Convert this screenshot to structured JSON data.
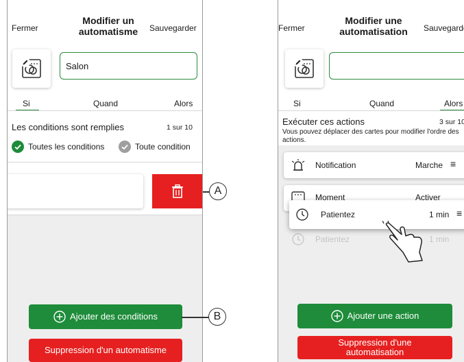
{
  "left": {
    "close_label": "Fermer",
    "title_line1": "Modifier un",
    "title_line2": "automatisme",
    "save_label": "Sauvegarder",
    "name_value": "Salon",
    "tabs": [
      "Si",
      "Quand",
      "Alors"
    ],
    "conditions_heading": "Les conditions sont remplies",
    "conditions_count": "1 sur 10",
    "option_all": "Toutes les conditions",
    "option_any": "Toute condition",
    "add_conditions_label": "Ajouter des conditions",
    "delete_automation_label": "Suppression d'un automatisme"
  },
  "right": {
    "close_label": "Fermer",
    "title_line1": "Modifier une",
    "title_line2": "automatisation",
    "save_label": "Sauvegarder",
    "tabs": [
      "Si",
      "Quand",
      "Alors"
    ],
    "actions_heading": "Exécuter ces actions",
    "actions_count": "3 sur 10",
    "actions_hint": "Vous pouvez déplacer des cartes pour modifier l'ordre des actions.",
    "actions": [
      {
        "label": "Notification",
        "value": "Marche"
      },
      {
        "label": "Moment",
        "value": "Activer"
      },
      {
        "label": "Patientez",
        "value": "1 min"
      }
    ],
    "dragging_card": {
      "label": "Patientez",
      "value": "1 min"
    },
    "add_action_label": "Ajouter une action",
    "delete_automation_label": "Suppression d'une automatisation"
  },
  "callouts": {
    "a": "A",
    "b": "B"
  },
  "colors": {
    "accent_green": "#1e8c3a",
    "delete_red": "#e62020",
    "border_green": "#2b8a3e"
  }
}
